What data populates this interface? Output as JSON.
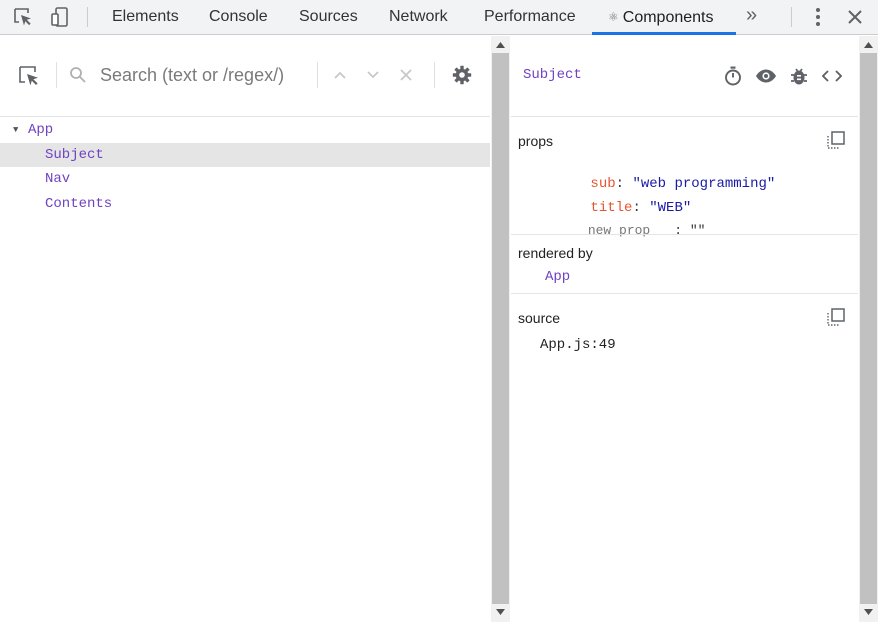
{
  "tabs": [
    {
      "label": "Elements"
    },
    {
      "label": "Console"
    },
    {
      "label": "Sources"
    },
    {
      "label": "Network"
    },
    {
      "label": "Performance"
    },
    {
      "label": "Components",
      "active": true
    }
  ],
  "more_tabs_glyph": "»",
  "search": {
    "placeholder": "Search (text or /regex/)",
    "value": ""
  },
  "tree": [
    {
      "label": "App",
      "depth": 0,
      "expanded": true
    },
    {
      "label": "Subject",
      "depth": 1,
      "selected": true
    },
    {
      "label": "Nav",
      "depth": 1
    },
    {
      "label": "Contents",
      "depth": 1
    }
  ],
  "inspector": {
    "component_name": "Subject",
    "props": {
      "title": "props",
      "items": [
        {
          "key": "sub",
          "value": "\"web programming\""
        },
        {
          "key": "title",
          "value": "\"WEB\""
        }
      ],
      "new_prop_placeholder": "new prop",
      "new_prop_sep": ":",
      "new_prop_value": "\"\""
    },
    "rendered_by": {
      "title": "rendered by",
      "owner": "App"
    },
    "source": {
      "title": "source",
      "location": "App.js:49"
    }
  },
  "colors": {
    "accent": "#1a73e8",
    "component": "#6f42c1",
    "prop_key": "#e5552f",
    "prop_value": "#1a1aa6"
  },
  "icons": [
    "inspect-element-icon",
    "device-toolbar-icon",
    "react-icon",
    "more-tabs-icon",
    "kebab-menu-icon",
    "close-icon",
    "search-icon",
    "chevron-up-icon",
    "chevron-down-icon",
    "clear-icon",
    "gear-icon",
    "stopwatch-icon",
    "eye-icon",
    "bug-icon",
    "code-icon",
    "copy-icon"
  ]
}
